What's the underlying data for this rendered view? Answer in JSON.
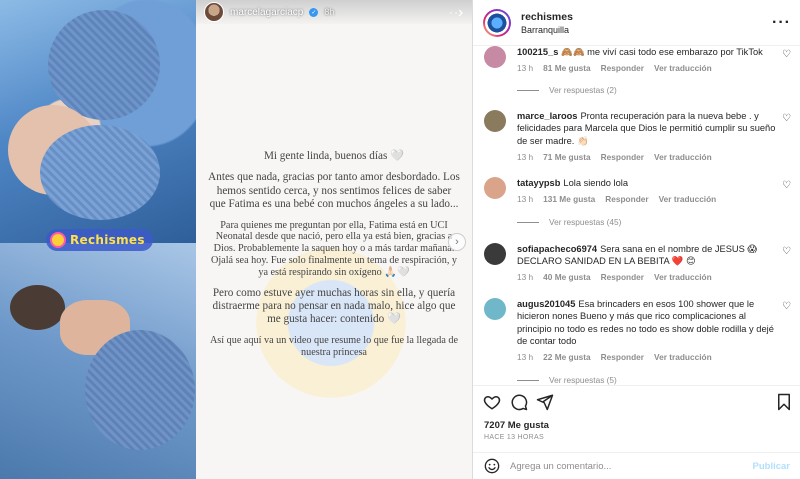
{
  "story": {
    "username": "marcelagarciacp",
    "time": "8h",
    "watermark": "Rechismes",
    "paragraphs": [
      "Mi gente linda, buenos días 🤍",
      "Antes que nada, gracias por tanto amor desbordado. Los hemos sentido cerca, y nos sentimos felices de saber que Fatima es una bebé con muchos ángeles a su lado...",
      "Para quienes me preguntan por ella, Fatima está en UCI Neonatal desde que nació, pero ella ya está bien, gracias a Dios. Probablemente la saquen hoy o a más tardar mañana. Ojalá sea hoy. Fue solo finalmente un tema de respiración, y ya está respirando sin oxígeno 🙏🏻🤍",
      "Pero como estuve ayer muchas horas sin ella, y quería distraerme para no pensar en nada malo, hice algo que me gusta hacer: contenido 🤍",
      "Así que aquí va un video que resume lo que fue la llegada de nuestra princesa"
    ]
  },
  "post": {
    "username": "rechismes",
    "location": "Barranquilla",
    "likes": "7207 Me gusta",
    "posted": "HACE 13 HORAS",
    "comment_placeholder": "Agrega un comentario...",
    "publish_label": "Publicar"
  },
  "comments": [
    {
      "user": "100215_s",
      "text": "🙈🙈 me viví casi todo ese embarazo por TikTok",
      "time": "13 h",
      "likes": "81 Me gusta",
      "reply": "Responder",
      "translate": "Ver traducción",
      "replies": "Ver respuestas (2)",
      "avatar_color": "#c78aa4"
    },
    {
      "user": "marce_laroos",
      "text": "Pronta recuperación para la nueva bebe . y felicidades para Marcela que Dios le permitió cumplir su sueño de ser madre. 👏🏻",
      "time": "13 h",
      "likes": "71 Me gusta",
      "reply": "Responder",
      "translate": "Ver traducción",
      "replies": "",
      "avatar_color": "#8a7a5e"
    },
    {
      "user": "tatayypsb",
      "text": "Lola siendo lola",
      "time": "13 h",
      "likes": "131 Me gusta",
      "reply": "Responder",
      "translate": "Ver traducción",
      "replies": "Ver respuestas (45)",
      "avatar_color": "#d9a48a"
    },
    {
      "user": "sofiapacheco6974",
      "text": "Sera sana en el nombre de JESUS 😱 DECLARO SANIDAD EN LA BEBITA ❤️ 😊",
      "time": "13 h",
      "likes": "40 Me gusta",
      "reply": "Responder",
      "translate": "Ver traducción",
      "replies": "",
      "avatar_color": "#3a3a3a"
    },
    {
      "user": "augus201045",
      "text": "Esa brincaders en esos 100 shower que le hicieron nones Bueno y más que rico complicaciones al principio no todo es redes no todo es show doble rodilla y dejé de contar todo",
      "time": "13 h",
      "likes": "22 Me gusta",
      "reply": "Responder",
      "translate": "Ver traducción",
      "replies": "Ver respuestas (5)",
      "avatar_color": "#6fb7c9"
    }
  ],
  "icons": {
    "like": "heart-icon",
    "comment": "comment-icon",
    "share": "send-icon",
    "save": "bookmark-icon",
    "emoji": "smiley-icon"
  }
}
